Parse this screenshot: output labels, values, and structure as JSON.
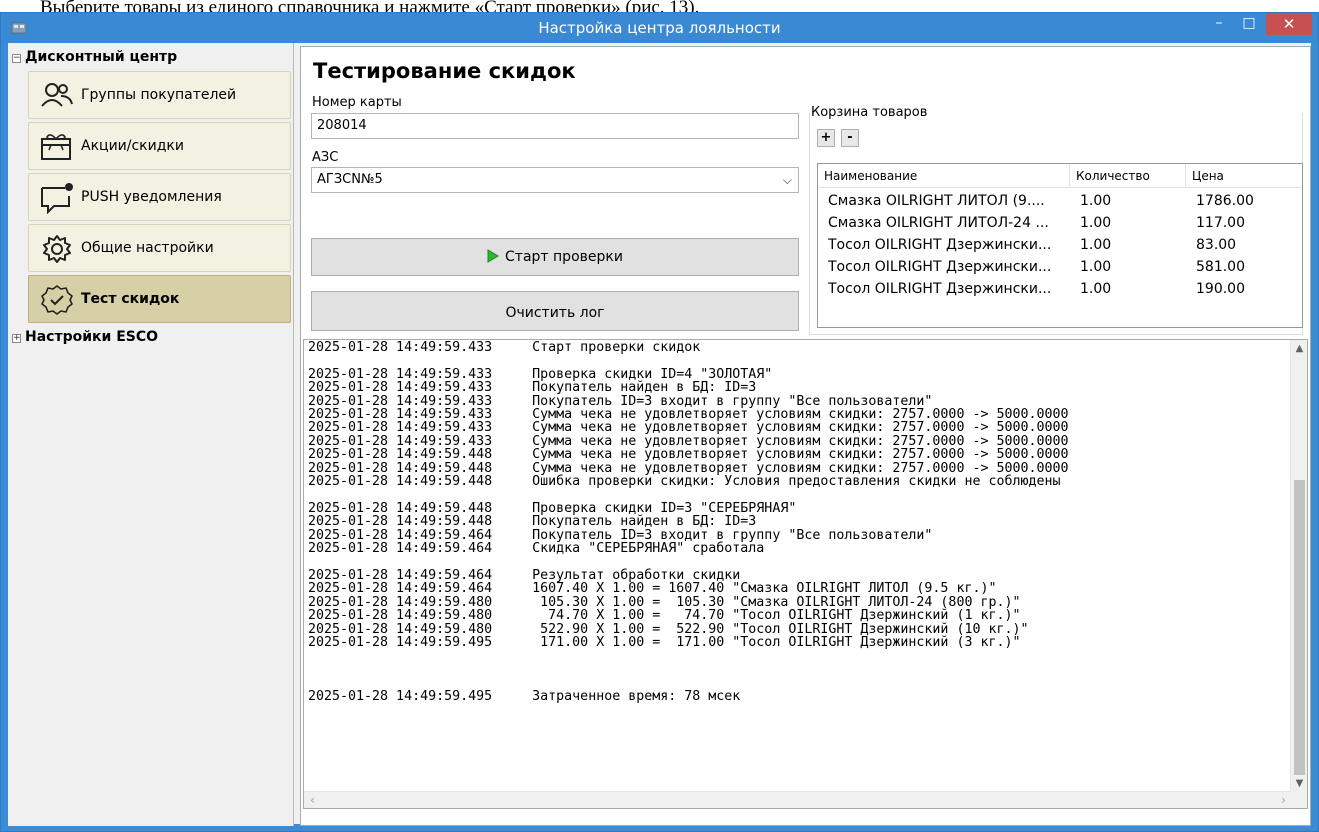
{
  "document": {
    "text": "Выберите товары из единого справочника и нажмите «Старт проверки» (рис. 13)."
  },
  "window": {
    "title": "Настройка центра лояльности",
    "minimize": "–",
    "maximize": "□",
    "close": "✕"
  },
  "sidebar": {
    "group_discount": "Дисконтный центр",
    "group_esco": "Настройки ESCO",
    "items": [
      {
        "label": "Группы покупателей"
      },
      {
        "label": "Акции/скидки"
      },
      {
        "label": "PUSH уведомления"
      },
      {
        "label": "Общие настройки"
      },
      {
        "label": "Тест скидок"
      }
    ]
  },
  "main": {
    "title": "Тестирование скидок",
    "card_label": "Номер карты",
    "card_value": "208014",
    "station_label": "АЗС",
    "station_value": "АГЗСN№5",
    "start_button": "Старт проверки",
    "clear_button": "Очистить лог"
  },
  "cart": {
    "legend": "Корзина товаров",
    "add": "+",
    "remove": "-",
    "columns": [
      "Наименование",
      "Количество",
      "Цена"
    ],
    "rows": [
      [
        "Смазка OILRIGHT ЛИТОЛ (9....",
        "1.00",
        "1786.00"
      ],
      [
        "Смазка OILRIGHT ЛИТОЛ-24 ...",
        "1.00",
        "117.00"
      ],
      [
        "Тосол OILRIGHT Дзержински...",
        "1.00",
        "83.00"
      ],
      [
        "Тосол OILRIGHT Дзержински...",
        "1.00",
        "581.00"
      ],
      [
        "Тосол OILRIGHT Дзержински...",
        "1.00",
        "190.00"
      ]
    ]
  },
  "log": {
    "lines": [
      "2025-01-28 14:49:59.433     Старт проверки скидок",
      "",
      "2025-01-28 14:49:59.433     Проверка скидки ID=4 \"ЗОЛОТАЯ\"",
      "2025-01-28 14:49:59.433     Покупатель найден в БД: ID=3",
      "2025-01-28 14:49:59.433     Покупатель ID=3 входит в группу \"Все пользователи\"",
      "2025-01-28 14:49:59.433     Сумма чека не удовлетворяет условиям скидки: 2757.0000 -> 5000.0000",
      "2025-01-28 14:49:59.433     Сумма чека не удовлетворяет условиям скидки: 2757.0000 -> 5000.0000",
      "2025-01-28 14:49:59.433     Сумма чека не удовлетворяет условиям скидки: 2757.0000 -> 5000.0000",
      "2025-01-28 14:49:59.448     Сумма чека не удовлетворяет условиям скидки: 2757.0000 -> 5000.0000",
      "2025-01-28 14:49:59.448     Сумма чека не удовлетворяет условиям скидки: 2757.0000 -> 5000.0000",
      "2025-01-28 14:49:59.448     Ошибка проверки скидки: Условия предоставления скидки не соблюдены",
      "",
      "2025-01-28 14:49:59.448     Проверка скидки ID=3 \"СЕРЕБРЯНАЯ\"",
      "2025-01-28 14:49:59.448     Покупатель найден в БД: ID=3",
      "2025-01-28 14:49:59.464     Покупатель ID=3 входит в группу \"Все пользователи\"",
      "2025-01-28 14:49:59.464     Скидка \"СЕРЕБРЯНАЯ\" сработала",
      "",
      "2025-01-28 14:49:59.464     Результат обработки скидки",
      "2025-01-28 14:49:59.464     1607.40 X 1.00 = 1607.40 \"Смазка OILRIGHT ЛИТОЛ (9.5 кг.)\"",
      "2025-01-28 14:49:59.480      105.30 X 1.00 =  105.30 \"Смазка OILRIGHT ЛИТОЛ-24 (800 гр.)\"",
      "2025-01-28 14:49:59.480       74.70 X 1.00 =   74.70 \"Тосол OILRIGHT Дзержинский (1 кг.)\"",
      "2025-01-28 14:49:59.480      522.90 X 1.00 =  522.90 \"Тосол OILRIGHT Дзержинский (10 кг.)\"",
      "2025-01-28 14:49:59.495      171.00 X 1.00 =  171.00 \"Тосол OILRIGHT Дзержинский (3 кг.)\"",
      "",
      "",
      "",
      "2025-01-28 14:49:59.495     Затраченное время: 78 мсек"
    ]
  },
  "colors": {
    "titlebar": "#3a89d4",
    "close_button": "#c75050",
    "nav_button": "#f3f1e2",
    "nav_button_active": "#d7d0a6",
    "start_icon": "#2fb52f"
  }
}
